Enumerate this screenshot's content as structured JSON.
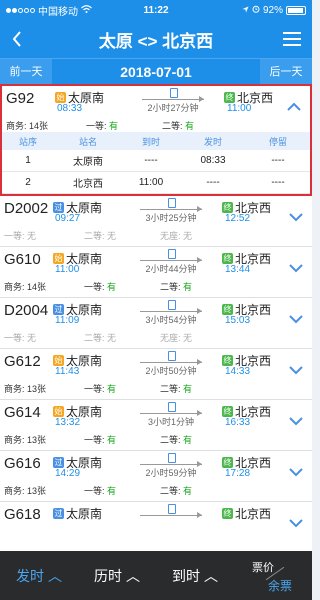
{
  "status": {
    "carrier": "中国移动",
    "time": "11:22",
    "battery": "92%",
    "battery_level": 0.92
  },
  "nav": {
    "back_icon": "chevron-left-icon",
    "title": "太原 <> 北京西",
    "menu_icon": "menu-icon"
  },
  "date_bar": {
    "prev": "前一天",
    "date": "2018-07-01",
    "next": "后一天"
  },
  "trains": [
    {
      "code": "G92",
      "from": "太原南",
      "from_tag": "始",
      "dep": "08:33",
      "duration": "2小时27分钟",
      "to": "北京西",
      "to_tag": "终",
      "arr": "11:00",
      "seats": [
        {
          "label": "商务: ",
          "value": "14张"
        },
        {
          "label": "一等: ",
          "value": "有"
        },
        {
          "label": "二等: ",
          "value": "有"
        }
      ],
      "stops": {
        "headers": [
          "站序",
          "站名",
          "到时",
          "发时",
          "停留"
        ],
        "rows": [
          [
            "1",
            "太原南",
            "----",
            "08:33",
            "----"
          ],
          [
            "2",
            "北京西",
            "11:00",
            "----",
            "----"
          ]
        ]
      }
    },
    {
      "code": "D2002",
      "from": "太原南",
      "from_tag": "过",
      "dep": "09:27",
      "duration": "3小时25分钟",
      "to": "北京西",
      "to_tag": "终",
      "arr": "12:52",
      "seats": [
        {
          "label": "一等: ",
          "value": "无"
        },
        {
          "label": "二等: ",
          "value": "无"
        },
        {
          "label": "无座: ",
          "value": "无"
        }
      ]
    },
    {
      "code": "G610",
      "from": "太原南",
      "from_tag": "始",
      "dep": "11:00",
      "duration": "2小时44分钟",
      "to": "北京西",
      "to_tag": "终",
      "arr": "13:44",
      "seats": [
        {
          "label": "商务: ",
          "value": "14张"
        },
        {
          "label": "一等: ",
          "value": "有"
        },
        {
          "label": "二等: ",
          "value": "有"
        }
      ]
    },
    {
      "code": "D2004",
      "from": "太原南",
      "from_tag": "过",
      "dep": "11:09",
      "duration": "3小时54分钟",
      "to": "北京西",
      "to_tag": "终",
      "arr": "15:03",
      "seats": [
        {
          "label": "一等: ",
          "value": "无"
        },
        {
          "label": "二等: ",
          "value": "无"
        },
        {
          "label": "无座: ",
          "value": "无"
        }
      ]
    },
    {
      "code": "G612",
      "from": "太原南",
      "from_tag": "始",
      "dep": "11:43",
      "duration": "2小时50分钟",
      "to": "北京西",
      "to_tag": "终",
      "arr": "14:33",
      "seats": [
        {
          "label": "商务: ",
          "value": "13张"
        },
        {
          "label": "一等: ",
          "value": "有"
        },
        {
          "label": "二等: ",
          "value": "有"
        }
      ]
    },
    {
      "code": "G614",
      "from": "太原南",
      "from_tag": "始",
      "dep": "13:32",
      "duration": "3小时1分钟",
      "to": "北京西",
      "to_tag": "终",
      "arr": "16:33",
      "seats": [
        {
          "label": "商务: ",
          "value": "13张"
        },
        {
          "label": "一等: ",
          "value": "有"
        },
        {
          "label": "二等: ",
          "value": "有"
        }
      ]
    },
    {
      "code": "G616",
      "from": "太原南",
      "from_tag": "过",
      "dep": "14:29",
      "duration": "2小时59分钟",
      "to": "北京西",
      "to_tag": "终",
      "arr": "17:28",
      "seats": [
        {
          "label": "商务: ",
          "value": "13张"
        },
        {
          "label": "一等: ",
          "value": "有"
        },
        {
          "label": "二等: ",
          "value": "有"
        }
      ]
    },
    {
      "code": "G618",
      "from": "太原南",
      "from_tag": "过",
      "dep": "",
      "duration": "",
      "to": "北京西",
      "to_tag": "终",
      "arr": "",
      "seats": []
    }
  ],
  "tabs": {
    "depart": "发时",
    "duration": "历时",
    "arrive": "到时",
    "price": "票价",
    "remain": "余票",
    "sort_icon": "chevron-up-icon"
  },
  "colors": {
    "accent": "#1e8fe8",
    "available": "#19a81e",
    "highlight_border": "#d9303a"
  }
}
